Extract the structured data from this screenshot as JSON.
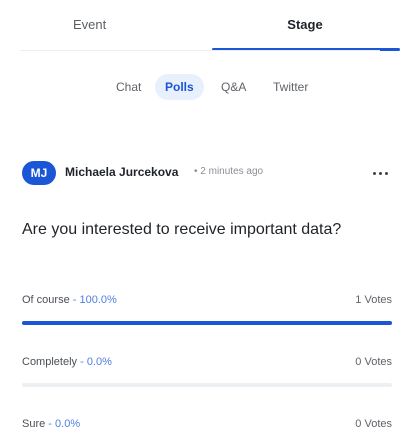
{
  "top_tabs": {
    "event": "Event",
    "stage": "Stage"
  },
  "sub_tabs": {
    "chat": "Chat",
    "polls": "Polls",
    "qa": "Q&A",
    "twitter": "Twitter"
  },
  "post": {
    "avatar_initials": "MJ",
    "author": "Michaela Jurcekova",
    "meta": "• 2 minutes ago",
    "more_icon": "more-horizontal-icon"
  },
  "poll": {
    "question": "Are you interested to receive important data?",
    "options": [
      {
        "label": "Of course",
        "sep": " - ",
        "percent": "100.0%",
        "votes": "1 Votes",
        "fill": 1.0
      },
      {
        "label": "Completely",
        "sep": " - ",
        "percent": "0.0%",
        "votes": "0 Votes",
        "fill": 0.0
      },
      {
        "label": "Sure",
        "sep": " - ",
        "percent": "0.0%",
        "votes": "0 Votes",
        "fill": 0.0
      }
    ]
  },
  "colors": {
    "accent": "#1a56d6",
    "accent_light": "#e8effd",
    "percent_text": "#4f7fe0"
  }
}
